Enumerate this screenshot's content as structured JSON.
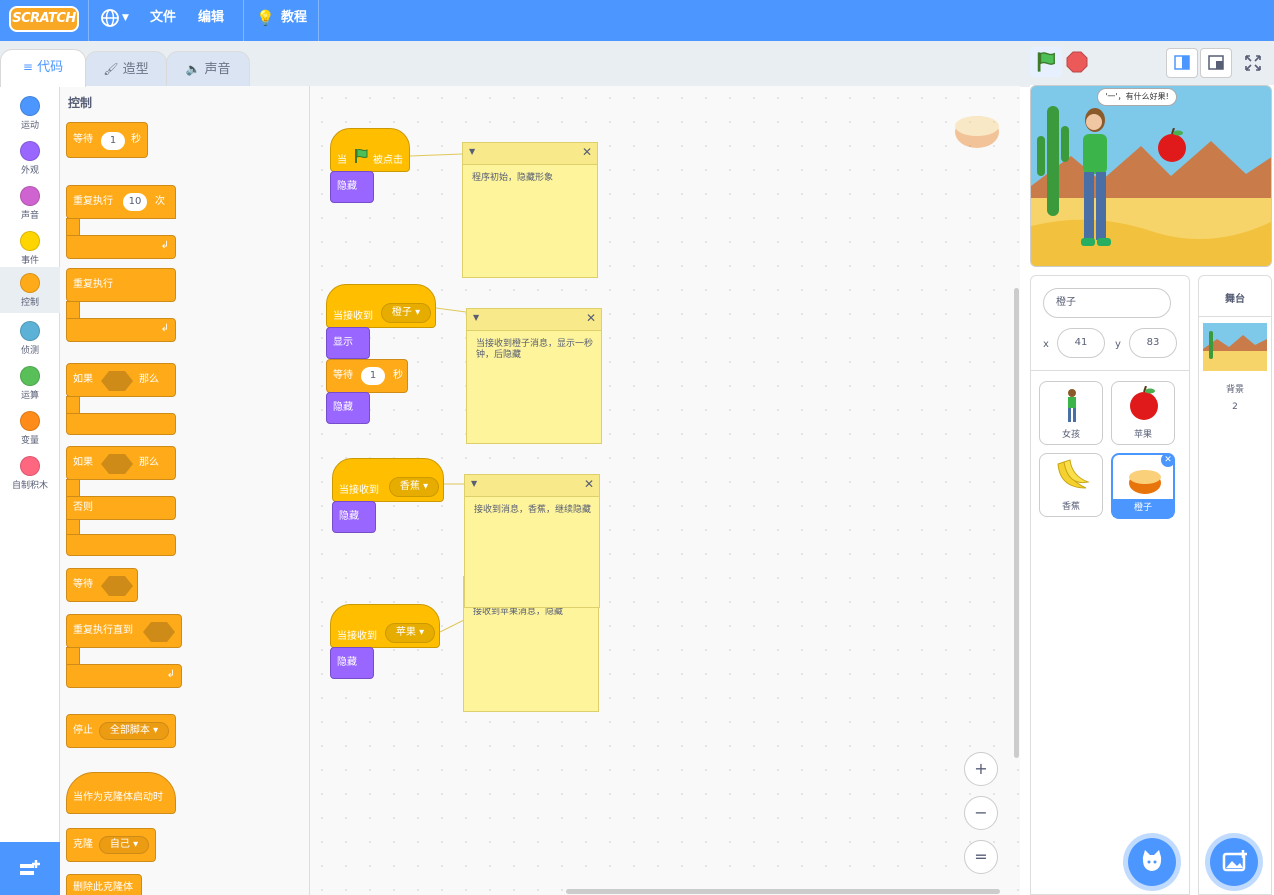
{
  "menu": {
    "logo": "SCRATCH",
    "file": "文件",
    "edit": "编辑",
    "tutorials": "教程"
  },
  "tabs": {
    "code": "代码",
    "costumes": "造型",
    "sounds": "声音"
  },
  "categories": [
    {
      "label": "运动",
      "color": "#4c97ff"
    },
    {
      "label": "外观",
      "color": "#9966ff"
    },
    {
      "label": "声音",
      "color": "#cf63cf"
    },
    {
      "label": "事件",
      "color": "#ffd500"
    },
    {
      "label": "控制",
      "color": "#ffab19"
    },
    {
      "label": "侦测",
      "color": "#5cb1d6"
    },
    {
      "label": "运算",
      "color": "#59c059"
    },
    {
      "label": "变量",
      "color": "#ff8c1a"
    },
    {
      "label": "自制积木",
      "color": "#ff6680"
    }
  ],
  "palette": {
    "title": "控制",
    "wait": "等待",
    "wait_val": "1",
    "sec": "秒",
    "repeat": "重复执行",
    "repeat_val": "10",
    "times": "次",
    "forever": "重复执行",
    "if1": "如果",
    "then1": "那么",
    "if2": "如果",
    "then2": "那么",
    "else": "否则",
    "wait_until": "等待",
    "repeat_until": "重复执行直到",
    "stop": "停止",
    "stop_opt": "全部脚本 ▾",
    "clone_start": "当作为克隆体启动时",
    "clone": "克隆",
    "clone_opt": "自己 ▾",
    "delete_clone": "删除此克隆体"
  },
  "scripts": {
    "s1_when": "当",
    "s1_clicked": "被点击",
    "s1_hide": "隐藏",
    "s2_when": "当接收到",
    "s2_msg": "橙子 ▾",
    "s2_show": "显示",
    "s2_wait": "等待",
    "s2_wait_val": "1",
    "s2_sec": "秒",
    "s2_hide": "隐藏",
    "s3_when": "当接收到",
    "s3_msg": "香蕉 ▾",
    "s3_hide": "隐藏",
    "s4_when": "当接收到",
    "s4_msg": "苹果 ▾",
    "s4_hide": "隐藏"
  },
  "notes": [
    "程序初始，隐藏形象",
    "当接收到橙子消息，显示一秒钟，后隐藏",
    "接收到消息，香蕉，继续隐藏",
    "接收到苹果消息，隐藏"
  ],
  "stage": {
    "speech": "'一'，有什么好果!"
  },
  "sprite_info": {
    "name": "橙子",
    "x_label": "x",
    "x": "41",
    "y_label": "y",
    "y": "83"
  },
  "sprites": [
    {
      "name": "女孩",
      "selected": false
    },
    {
      "name": "苹果",
      "selected": false
    },
    {
      "name": "香蕉",
      "selected": false
    },
    {
      "name": "橙子",
      "selected": true
    }
  ],
  "stage_pane": {
    "title": "舞台",
    "backdrops_label": "背景",
    "backdrops_count": "2"
  },
  "zoom": {
    "in": "+",
    "out": "−",
    "reset": "="
  }
}
